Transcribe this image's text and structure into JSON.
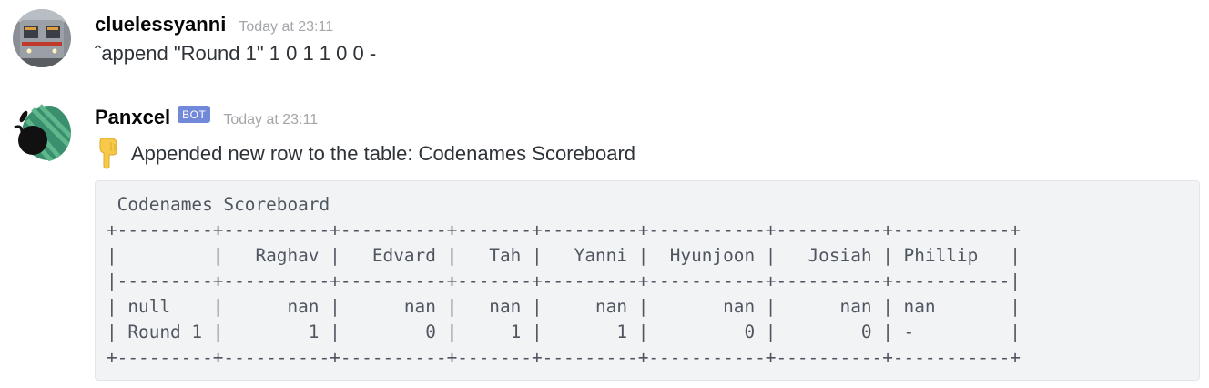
{
  "messages": [
    {
      "username": "cluelessyanni",
      "timestamp": "Today at 23:11",
      "text": "ˆappend \"Round 1\" 1 0 1 1 0 0 -",
      "avatar_icon": "subway-train-avatar"
    },
    {
      "username": "Panxcel",
      "bot_tag": "BOT",
      "timestamp": "Today at 23:11",
      "emoji_icon": "pointing-down-emoji",
      "text": "Appended new row to the table: Codenames Scoreboard",
      "avatar_icon": "panda-avatar",
      "code_block": " Codenames Scoreboard\n+---------+----------+----------+-------+---------+-----------+----------+-----------+\n|         |   Raghav |   Edvard |   Tah |   Yanni |  Hyunjoon |   Josiah | Phillip   |\n|---------+----------+----------+-------+---------+-----------+----------+-----------|\n| null    |      nan |      nan |   nan |     nan |       nan |      nan | nan       |\n| Round 1 |        1 |        0 |     1 |       1 |         0 |        0 | -         |\n+---------+----------+----------+-------+---------+-----------+----------+-----------+"
    }
  ],
  "colors": {
    "bot_tag": "#7289da",
    "timestamp": "#a3a6aa",
    "code_bg": "#f2f3f5"
  }
}
